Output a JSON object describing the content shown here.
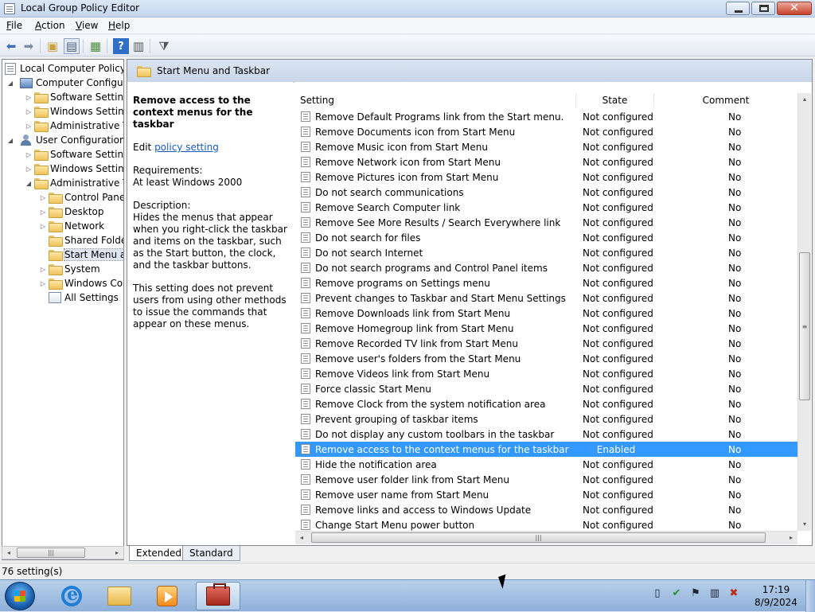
{
  "window": {
    "title": "Local Group Policy Editor"
  },
  "menu": {
    "file": {
      "u": "F",
      "rest": "ile"
    },
    "action": {
      "u": "A",
      "rest": "ction"
    },
    "view": {
      "u": "V",
      "rest": "iew"
    },
    "help": {
      "u": "H",
      "rest": "elp"
    }
  },
  "tree": {
    "items": [
      {
        "label": "Local Computer Policy"
      },
      {
        "label": "Computer Configura"
      },
      {
        "label": "Software Settings"
      },
      {
        "label": "Windows Setting"
      },
      {
        "label": "Administrative Te"
      },
      {
        "label": "User Configuration"
      },
      {
        "label": "Software Settings"
      },
      {
        "label": "Windows Setting"
      },
      {
        "label": "Administrative Te"
      },
      {
        "label": "Control Panel"
      },
      {
        "label": "Desktop"
      },
      {
        "label": "Network"
      },
      {
        "label": "Shared Folder"
      },
      {
        "label": "Start Menu ar"
      },
      {
        "label": "System"
      },
      {
        "label": "Windows Cor"
      },
      {
        "label": "All Settings"
      }
    ]
  },
  "pane": {
    "title": "Start Menu and Taskbar"
  },
  "description": {
    "title": "Remove access to the context menus for the taskbar",
    "edit_prefix": "Edit ",
    "edit_link": "policy setting",
    "requirements_label": "Requirements:",
    "requirements_value": "At least Windows 2000",
    "description_label": "Description:",
    "description_text": "Hides the menus that appear when you right-click the taskbar and items on the taskbar, such as the Start button, the clock, and the taskbar buttons.",
    "note_text": "This setting does not prevent users from using other methods to issue the commands that appear on these menus."
  },
  "list": {
    "columns": {
      "setting": "Setting",
      "state": "State",
      "comment": "Comment"
    },
    "rows": [
      {
        "setting": "Remove Default Programs link from the Start menu.",
        "state": "Not configured",
        "comment": "No"
      },
      {
        "setting": "Remove Documents icon from Start Menu",
        "state": "Not configured",
        "comment": "No"
      },
      {
        "setting": "Remove Music icon from Start Menu",
        "state": "Not configured",
        "comment": "No"
      },
      {
        "setting": "Remove Network icon from Start Menu",
        "state": "Not configured",
        "comment": "No"
      },
      {
        "setting": "Remove Pictures icon from Start Menu",
        "state": "Not configured",
        "comment": "No"
      },
      {
        "setting": "Do not search communications",
        "state": "Not configured",
        "comment": "No"
      },
      {
        "setting": "Remove Search Computer link",
        "state": "Not configured",
        "comment": "No"
      },
      {
        "setting": "Remove See More Results / Search Everywhere link",
        "state": "Not configured",
        "comment": "No"
      },
      {
        "setting": "Do not search for files",
        "state": "Not configured",
        "comment": "No"
      },
      {
        "setting": "Do not search Internet",
        "state": "Not configured",
        "comment": "No"
      },
      {
        "setting": "Do not search programs and Control Panel items",
        "state": "Not configured",
        "comment": "No"
      },
      {
        "setting": "Remove programs on Settings menu",
        "state": "Not configured",
        "comment": "No"
      },
      {
        "setting": "Prevent changes to Taskbar and Start Menu Settings",
        "state": "Not configured",
        "comment": "No"
      },
      {
        "setting": "Remove Downloads link from Start Menu",
        "state": "Not configured",
        "comment": "No"
      },
      {
        "setting": "Remove Homegroup link from Start Menu",
        "state": "Not configured",
        "comment": "No"
      },
      {
        "setting": "Remove Recorded TV link from Start Menu",
        "state": "Not configured",
        "comment": "No"
      },
      {
        "setting": "Remove user's folders from the Start Menu",
        "state": "Not configured",
        "comment": "No"
      },
      {
        "setting": "Remove Videos link from Start Menu",
        "state": "Not configured",
        "comment": "No"
      },
      {
        "setting": "Force classic Start Menu",
        "state": "Not configured",
        "comment": "No"
      },
      {
        "setting": "Remove Clock from the system notification area",
        "state": "Not configured",
        "comment": "No"
      },
      {
        "setting": "Prevent grouping of taskbar items",
        "state": "Not configured",
        "comment": "No"
      },
      {
        "setting": "Do not display any custom toolbars in the taskbar",
        "state": "Not configured",
        "comment": "No"
      },
      {
        "setting": "Remove access to the context menus for the taskbar",
        "state": "Enabled",
        "comment": "No"
      },
      {
        "setting": "Hide the notification area",
        "state": "Not configured",
        "comment": "No"
      },
      {
        "setting": "Remove user folder link from Start Menu",
        "state": "Not configured",
        "comment": "No"
      },
      {
        "setting": "Remove user name from Start Menu",
        "state": "Not configured",
        "comment": "No"
      },
      {
        "setting": "Remove links and access to Windows Update",
        "state": "Not configured",
        "comment": "No"
      },
      {
        "setting": "Change Start Menu power button",
        "state": "Not configured",
        "comment": "No"
      }
    ]
  },
  "tabs": {
    "extended": "Extended",
    "standard": "Standard"
  },
  "status": {
    "text": "76 setting(s)"
  },
  "clock": {
    "time": "17:19",
    "date": "8/9/2024"
  },
  "icons": {
    "scroll_left": "◂",
    "scroll_right": "▸",
    "scroll_up": "▴",
    "scroll_down": "▾",
    "grip": "|||",
    "grip_v": "≡"
  }
}
